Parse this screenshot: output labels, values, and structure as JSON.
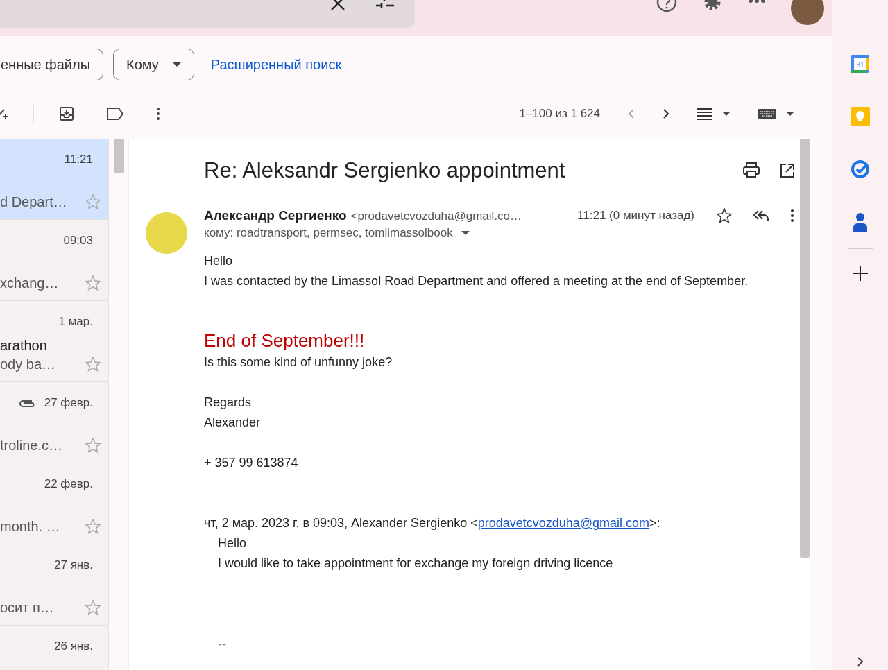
{
  "filters": [
    {
      "label": "енные файлы",
      "has_caret": false
    },
    {
      "label": "Кому",
      "has_caret": true
    }
  ],
  "advanced_search": "Расширенный поиск",
  "pagination": {
    "range": "1–100 из 1 624",
    "prev_disabled": true,
    "next_disabled": false
  },
  "message_list": [
    {
      "time": "11:21",
      "snippet": "d Depart…",
      "attachment": false,
      "selected": true,
      "starred": false
    },
    {
      "time": "09:03",
      "snippet": "xchang…",
      "attachment": false,
      "selected": false,
      "starred": false
    },
    {
      "time": "1 мар.",
      "subject": "arathon",
      "snippet": "ody ba…",
      "attachment": false,
      "selected": false,
      "starred": false
    },
    {
      "time": "27 февр.",
      "snippet": "troline.c…",
      "attachment": true,
      "selected": false,
      "starred": false
    },
    {
      "time": "22 февр.",
      "snippet": "month. …",
      "attachment": false,
      "selected": false,
      "starred": false
    },
    {
      "time": "27 янв.",
      "snippet": "осит п…",
      "attachment": false,
      "selected": false,
      "starred": false
    },
    {
      "time": "26 янв.",
      "attachment": false,
      "selected": false
    }
  ],
  "side_panel": {
    "calendar_day": "31"
  },
  "email": {
    "subject": "Re: Aleksandr Sergienko appointment",
    "sender_name": "Александр Сергиенко",
    "sender_email": "<prodavetcvozduha@gmail.co…",
    "time": "11:21 (0 минут назад)",
    "starred": false,
    "recipients": "кому: roadtransport, permsec, tomlimassolbook",
    "body": [
      {
        "kind": "text",
        "text": "Hello"
      },
      {
        "kind": "text",
        "text": "I was contacted by the Limassol Road Department and offered a meeting at the end of September."
      },
      {
        "kind": "gap"
      },
      {
        "kind": "gap"
      },
      {
        "kind": "highlight",
        "text": "End of September!!!"
      },
      {
        "kind": "text",
        "text": "Is this some kind of unfunny joke?"
      },
      {
        "kind": "gap"
      },
      {
        "kind": "text",
        "text": "Regards"
      },
      {
        "kind": "text",
        "text": "Alexander"
      },
      {
        "kind": "gap"
      },
      {
        "kind": "text",
        "text": "+ 357 99 613874"
      },
      {
        "kind": "gap"
      },
      {
        "kind": "gap"
      }
    ],
    "quote_header": {
      "before": "чт, 2 мар. 2023 г. в 09:03, Alexander Sergienko <",
      "link": "prodavetcvozduha@gmail.com",
      "after": ">:"
    },
    "quote": [
      "Hello",
      "I would like to take appointment for exchange my foreign driving licence"
    ],
    "signature": "--"
  }
}
